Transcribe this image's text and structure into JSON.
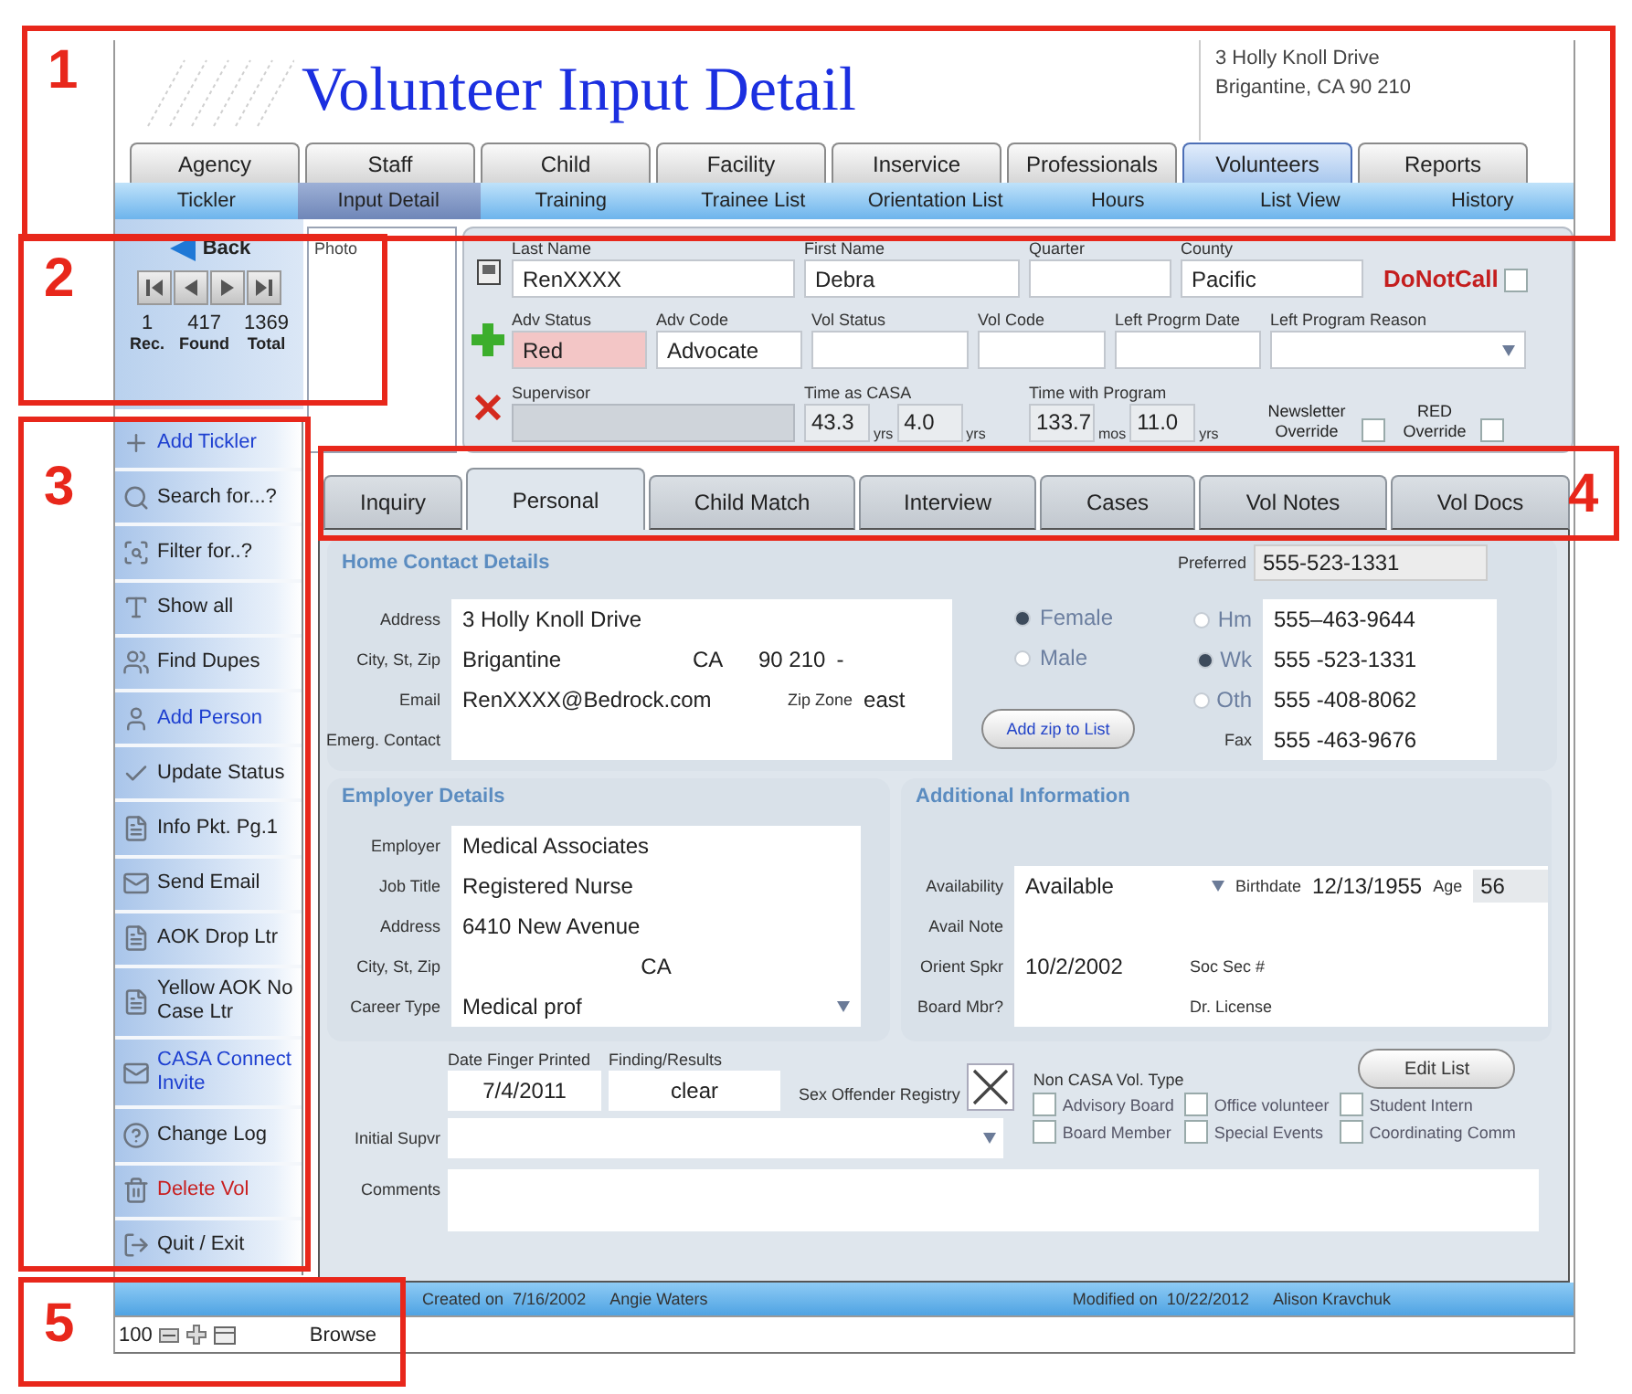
{
  "callouts": [
    {
      "number": "1"
    },
    {
      "number": "2"
    },
    {
      "number": "3"
    },
    {
      "number": "4"
    },
    {
      "number": "5"
    }
  ],
  "header": {
    "title": "Volunteer Input Detail",
    "address_lines": [
      "3 Holly Knoll Drive",
      "Brigantine,  CA  90 210"
    ]
  },
  "main_tabs": [
    {
      "label": "Agency",
      "selected": false
    },
    {
      "label": "Staff",
      "selected": false
    },
    {
      "label": "Child",
      "selected": false
    },
    {
      "label": "Facility",
      "selected": false
    },
    {
      "label": "Inservice",
      "selected": false
    },
    {
      "label": "Professionals",
      "selected": false
    },
    {
      "label": "Volunteers",
      "selected": true
    },
    {
      "label": "Reports",
      "selected": false
    }
  ],
  "sub_tabs": [
    {
      "label": "Tickler",
      "selected": false
    },
    {
      "label": "Input Detail",
      "selected": true
    },
    {
      "label": "Training",
      "selected": false
    },
    {
      "label": "Trainee List",
      "selected": false
    },
    {
      "label": "Orientation List",
      "selected": false
    },
    {
      "label": "Hours",
      "selected": false
    },
    {
      "label": "List View",
      "selected": false
    },
    {
      "label": "History",
      "selected": false
    }
  ],
  "navigator": {
    "back": "Back",
    "counts": [
      {
        "value": "1",
        "label": "Rec."
      },
      {
        "value": "417",
        "label": "Found"
      },
      {
        "value": "1369",
        "label": "Total"
      }
    ]
  },
  "sidebar": [
    {
      "label": "Add Tickler",
      "color": "#1d3fd0"
    },
    {
      "label": "Search for...?",
      "color": "#222222"
    },
    {
      "label": "Filter for..?",
      "color": "#222222"
    },
    {
      "label": "Show all",
      "color": "#222222"
    },
    {
      "label": "Find Dupes",
      "color": "#222222"
    },
    {
      "label": "Add Person",
      "color": "#1d3fd0"
    },
    {
      "label": "Update Status",
      "color": "#222222"
    },
    {
      "label": "Info Pkt. Pg.1",
      "color": "#222222"
    },
    {
      "label": "Send Email",
      "color": "#222222"
    },
    {
      "label": "AOK Drop Ltr",
      "color": "#222222"
    },
    {
      "label": "Yellow AOK No Case Ltr",
      "color": "#222222"
    },
    {
      "label": "CASA Connect Invite",
      "color": "#1d3fd0"
    },
    {
      "label": "Change Log",
      "color": "#222222"
    },
    {
      "label": "Delete Vol",
      "color": "#c81e1e"
    },
    {
      "label": "Quit / Exit",
      "color": "#222222"
    }
  ],
  "photo": {
    "label": "Photo"
  },
  "record_form": {
    "name_line": [
      {
        "kind": "text",
        "label": "Last Name",
        "value": "RenXXXX",
        "highlighted": false,
        "readonly": false
      },
      {
        "kind": "text",
        "label": "First Name",
        "value": "Debra",
        "highlighted": false,
        "readonly": false
      },
      {
        "kind": "text",
        "label": "Quarter",
        "highlighted": false,
        "readonly": false
      },
      {
        "kind": "text",
        "label": "County",
        "value": "Pacific",
        "highlighted": false,
        "readonly": false
      },
      {
        "kind": "flag",
        "label": "DoNotCall",
        "checked": false
      }
    ],
    "status_line": [
      {
        "kind": "text",
        "label": "Adv Status",
        "value": "Red",
        "highlighted": true,
        "readonly": false
      },
      {
        "kind": "text",
        "label": "Adv Code",
        "value": "Advocate",
        "highlighted": false,
        "readonly": false
      },
      {
        "kind": "text",
        "label": "Vol Status",
        "highlighted": false,
        "readonly": false
      },
      {
        "kind": "text",
        "label": "Vol Code",
        "highlighted": false,
        "readonly": false
      },
      {
        "kind": "text",
        "label": "Left Progrm Date",
        "highlighted": false,
        "readonly": false
      },
      {
        "kind": "dropdown",
        "label": "Left Program Reason"
      }
    ],
    "time_line": [
      {
        "kind": "text",
        "label": "Supervisor",
        "highlighted": false,
        "readonly": true
      },
      {
        "kind": "duration",
        "label": "Time as CASA",
        "parts": [
          {
            "value": "43.3",
            "unit": "yrs"
          },
          {
            "value": "4.0",
            "unit": "yrs"
          }
        ]
      },
      {
        "kind": "duration",
        "label": "Time with Program",
        "parts": [
          {
            "value": "133.7",
            "unit": "mos"
          },
          {
            "value": "11.0",
            "unit": "yrs"
          }
        ]
      },
      {
        "kind": "check",
        "label": "Newsletter Override",
        "checked": false
      },
      {
        "kind": "check",
        "label": "RED Override",
        "checked": false
      }
    ]
  },
  "detail_tabs": [
    {
      "label": "Inquiry",
      "selected": false
    },
    {
      "label": "Personal",
      "selected": true
    },
    {
      "label": "Child Match",
      "selected": false
    },
    {
      "label": "Interview",
      "selected": false
    },
    {
      "label": "Cases",
      "selected": false
    },
    {
      "label": "Vol Notes",
      "selected": false
    },
    {
      "label": "Vol Docs",
      "selected": false
    }
  ],
  "personal": {
    "home": {
      "title": "Home Contact Details",
      "preferred_label": "Preferred",
      "preferred": "555-523-1331",
      "address_labels": [
        "Address",
        "City, St, Zip",
        "Email",
        "Emerg. Contact"
      ],
      "address": "3 Holly Knoll Drive",
      "city": "Brigantine",
      "state": "CA",
      "zip": "90 210",
      "zip_suffix": "-",
      "email": "RenXXXX@Bedrock.com",
      "zip_zone_label": "Zip Zone",
      "zip_zone": "east",
      "gender": [
        {
          "label": "Female",
          "selected": true
        },
        {
          "label": "Male",
          "selected": false
        }
      ],
      "add_zip_button": "Add zip to List",
      "phones": [
        {
          "kind": "radio",
          "label": "Hm",
          "selected": false,
          "number": "555–463-9644"
        },
        {
          "kind": "radio",
          "label": "Wk",
          "selected": true,
          "number": "555 -523-1331"
        },
        {
          "kind": "radio",
          "label": "Oth",
          "selected": false,
          "number": "555 -408-8062"
        },
        {
          "kind": "plain",
          "label": "Fax",
          "number": "555 -463-9676"
        }
      ]
    },
    "employer": {
      "title": "Employer Details",
      "rows": [
        {
          "kind": "text",
          "label": "Employer",
          "value": "Medical Associates"
        },
        {
          "kind": "text",
          "label": "Job Title",
          "value": "Registered Nurse"
        },
        {
          "kind": "text",
          "label": "Address",
          "value": "6410 New Avenue"
        },
        {
          "kind": "city",
          "label": "City, St, Zip",
          "value": "CA"
        },
        {
          "kind": "dropdown",
          "label": "Career Type",
          "value": "Medical prof"
        }
      ]
    },
    "additional": {
      "title": "Additional Information",
      "availability_label": "Availability",
      "availability": "Available",
      "birthdate_label": "Birthdate",
      "birthdate": "12/13/1955",
      "age_label": "Age",
      "age": "56",
      "avail_note_label": "Avail Note",
      "orient_label": "Orient Spkr",
      "orient": "10/2/2002",
      "ssn_label": "Soc Sec #",
      "board_label": "Board Mbr?",
      "license_label": "Dr. License"
    },
    "screening": {
      "date_label": "Date Finger Printed",
      "date": "7/4/2011",
      "result_label": "Finding/Results",
      "result": "clear",
      "registry_label": "Sex Offender Registry",
      "registry_checked": true,
      "supervisor_label": "Initial Supvr",
      "comments_label": "Comments"
    },
    "non_casa": {
      "title": "Non CASA Vol. Type",
      "edit_button": "Edit List",
      "types": [
        {
          "label": "Advisory Board",
          "checked": false
        },
        {
          "label": "Office volunteer",
          "checked": false
        },
        {
          "label": "Student Intern",
          "checked": false
        },
        {
          "label": "Board Member",
          "checked": false
        },
        {
          "label": "Special Events",
          "checked": false
        },
        {
          "label": "Coordinating Comm",
          "checked": false
        }
      ]
    }
  },
  "footer": {
    "created_label": "Created on",
    "created_date": "7/16/2002",
    "created_by": "Angie Waters",
    "modified_label": "Modified on",
    "modified_date": "10/22/2012",
    "modified_by": "Alison Kravchuk"
  },
  "status_bar": {
    "zoom": "100",
    "mode": "Browse"
  }
}
